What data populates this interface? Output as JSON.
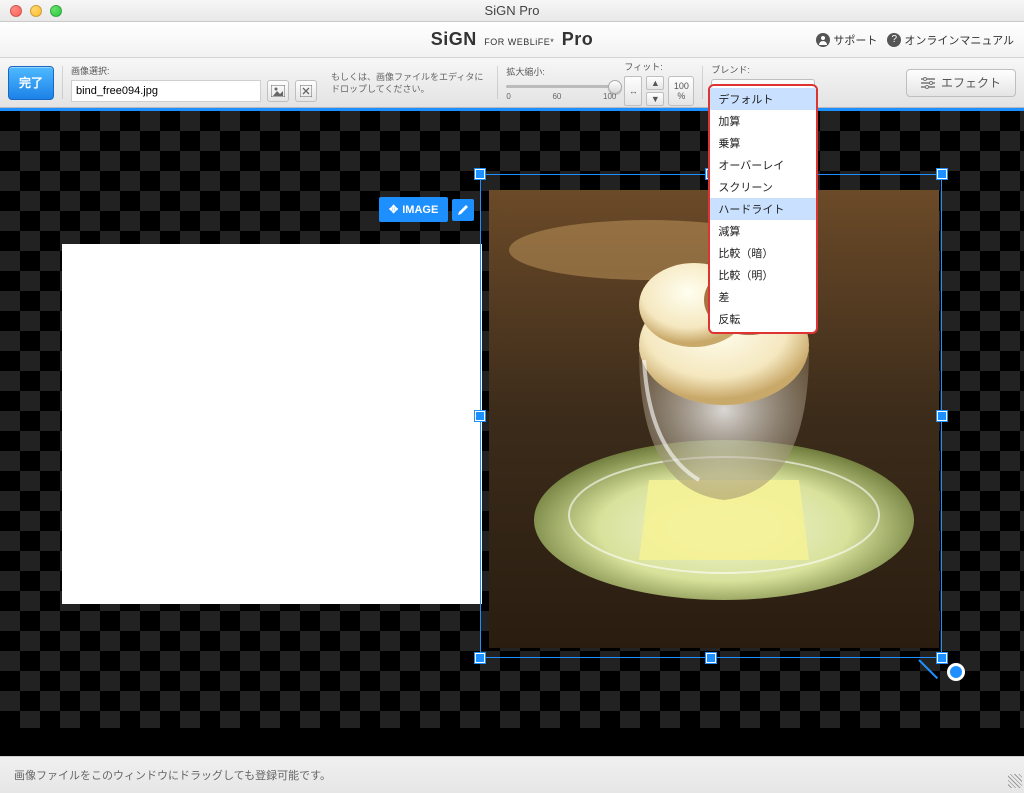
{
  "window": {
    "title": "SiGN Pro"
  },
  "brand": {
    "name": "SiGN",
    "sub": "FOR WEBLiFE*",
    "edition": "Pro"
  },
  "toplinks": {
    "support": "サポート",
    "manual": "オンラインマニュアル"
  },
  "toolbar": {
    "done": "完了",
    "image_select": {
      "label": "画像選択:",
      "value": "bind_free094.jpg"
    },
    "hint_line1": "もしくは、画像ファイルをエディタに",
    "hint_line2": "ドロップしてください。",
    "zoom": {
      "label": "拡大縮小:",
      "min": "0",
      "mid": "60",
      "max": "100"
    },
    "fit": {
      "label": "フィット:"
    },
    "pct": {
      "num": "100",
      "sym": "%"
    },
    "blend": {
      "label": "ブレンド:",
      "selected": "デフォルト",
      "options": [
        "デフォルト",
        "加算",
        "乗算",
        "オーバーレイ",
        "スクリーン",
        "ハードライト",
        "減算",
        "比較（暗）",
        "比較（明）",
        "差",
        "反転"
      ],
      "highlighted": "ハードライト"
    },
    "effect": "エフェクト"
  },
  "canvas": {
    "image_label": "IMAGE"
  },
  "footer": {
    "message": "画像ファイルをこのウィンドウにドラッグしても登録可能です。"
  }
}
